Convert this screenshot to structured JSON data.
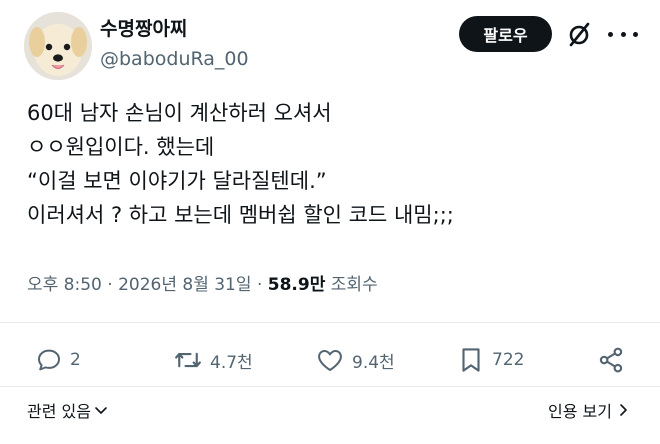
{
  "author": {
    "display_name": "수명짱아찌",
    "handle": "@baboduRa_00",
    "avatar_icon": "puppy-avatar"
  },
  "header": {
    "follow_label": "팔로우",
    "grok_icon": "grok-slash-icon",
    "more_icon": "more-dots-icon"
  },
  "tweet": {
    "lines": [
      "60대 남자 손님이 계산하러 오셔서",
      "ㅇㅇ원입이다. 했는데",
      "“이걸 보면 이야기가 달라질텐데.”",
      "이러셔서 ? 하고 보는데 멤버쉽 할인 코드 내밈;;;"
    ]
  },
  "meta": {
    "time": "오후 8:50",
    "separator": "·",
    "date": "2026년 8월 31일",
    "views_count": "58.9만",
    "views_label": "조회수"
  },
  "actions": {
    "replies": "2",
    "reposts": "4.7천",
    "likes": "9.4천",
    "bookmarks": "722"
  },
  "footer": {
    "related_label": "관련 있음",
    "quotes_label": "인용 보기"
  },
  "colors": {
    "text": "#0f1419",
    "muted": "#536471",
    "button_bg": "#0f1419",
    "divider": "#e6e8ea"
  }
}
